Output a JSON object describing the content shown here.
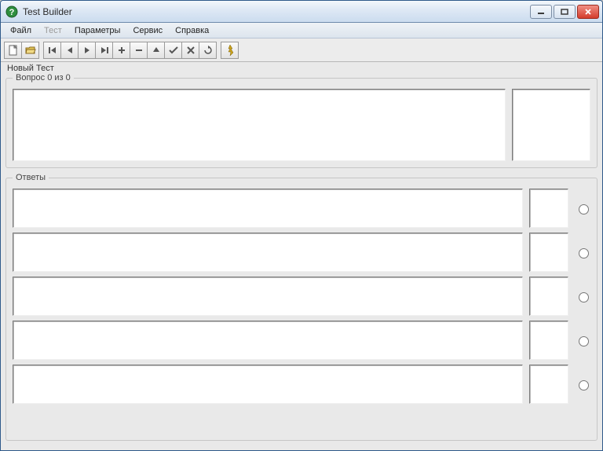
{
  "window": {
    "title": "Test Builder"
  },
  "menu": {
    "file": "Файл",
    "test": "Тест",
    "params": "Параметры",
    "service": "Сервис",
    "help": "Справка"
  },
  "toolbar_icons": {
    "new": "new",
    "open": "open",
    "first": "first",
    "prev": "prev",
    "next": "next",
    "last": "last",
    "add": "add",
    "remove": "remove",
    "up": "up",
    "down": "down",
    "check": "check",
    "cancel": "cancel",
    "refresh": "refresh",
    "run": "run"
  },
  "labels": {
    "new_test": "Новый Тест",
    "question_count": "Вопрос 0 из 0",
    "answers": "Ответы"
  },
  "answers": [
    {
      "text": "",
      "correct": false
    },
    {
      "text": "",
      "correct": false
    },
    {
      "text": "",
      "correct": false
    },
    {
      "text": "",
      "correct": false
    },
    {
      "text": "",
      "correct": false
    }
  ]
}
